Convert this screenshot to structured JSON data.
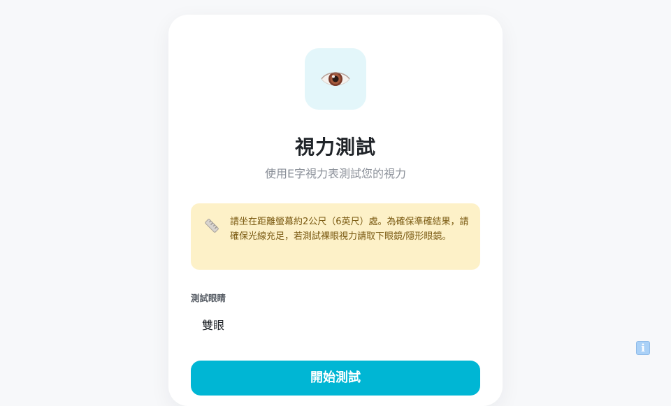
{
  "header": {
    "icon": "eye-icon",
    "title": "視力測試",
    "subtitle": "使用E字視力表測試您的視力"
  },
  "notice": {
    "icon": "ruler-icon",
    "text": "請坐在距離螢幕約2公尺（6英尺）處。為確保準確結果，請確保光線充足，若測試裸眼視力請取下眼鏡/隱形眼鏡。"
  },
  "eye_select": {
    "label": "測試眼睛",
    "value": "雙眼"
  },
  "start_button": {
    "label": "開始測試"
  },
  "info_button": {
    "label": "i"
  },
  "colors": {
    "accent": "#00b6d4",
    "notice_bg": "#fdf1c8",
    "notice_text": "#7a5a12",
    "icon_tile_bg": "#e3f6fa"
  }
}
